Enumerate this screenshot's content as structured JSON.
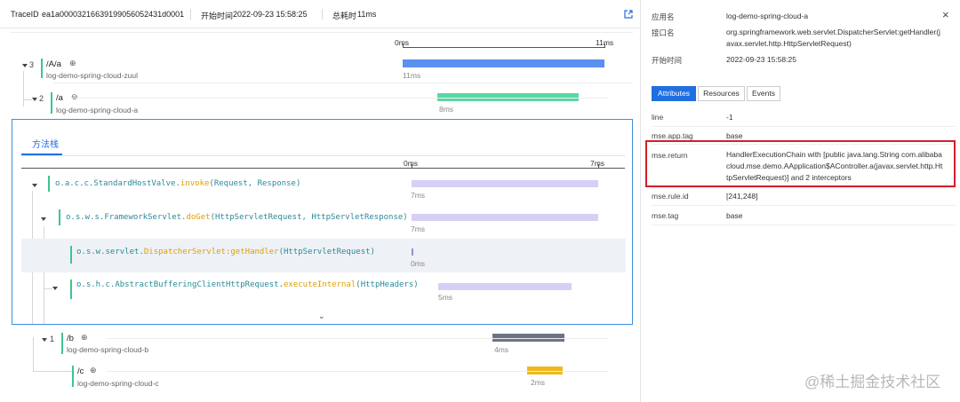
{
  "header": {
    "trace_label": "TraceID",
    "trace_id": "ea1a0000321663919905605243​1d0001",
    "start_label": "开始时间",
    "start_time": "2022-09-23 15:58:25",
    "total_label": "总耗时",
    "total_time": "11ms",
    "export_icon": "export-icon"
  },
  "timeline": {
    "start": "0ms",
    "end": "11ms"
  },
  "spans": [
    {
      "count": "3",
      "op": "/A/a",
      "service": "log-demo-spring-cloud-zuul",
      "duration": "11ms",
      "color": "#5b8ff0",
      "start_ms": 0,
      "dur_ms": 11
    },
    {
      "count": "2",
      "op": "/a",
      "service": "log-demo-spring-cloud-a",
      "duration": "8ms",
      "color": "#5ad7a4",
      "start_ms": 1.9,
      "dur_ms": 7.7
    },
    {
      "count": "1",
      "op": "/b",
      "service": "log-demo-spring-cloud-b",
      "duration": "4ms",
      "color": "#6b7485",
      "start_ms": 4.9,
      "dur_ms": 3.9
    },
    {
      "count": "",
      "op": "/c",
      "service": "log-demo-spring-cloud-c",
      "duration": "2ms",
      "color": "#f0b81c",
      "start_ms": 6.8,
      "dur_ms": 1.9
    }
  ],
  "stack": {
    "title": "方法栈",
    "scale_start": "0ms",
    "scale_end": "7ms",
    "methods": [
      {
        "cls": "o.a.c.c.StandardHostValve.",
        "meth": "invoke",
        "args": "(Request, Response)",
        "duration": "7ms",
        "start_ms": 0,
        "dur_ms": 7
      },
      {
        "cls": "o.s.w.s.FrameworkServlet.",
        "meth": "doGet",
        "args": "(HttpServletRequest, HttpServletResponse)",
        "duration": "7ms",
        "start_ms": 0,
        "dur_ms": 7
      },
      {
        "cls": "o.s.w.servlet.",
        "meth": "DispatcherServlet:getHandler",
        "args": "(HttpServletRequest)",
        "duration": "0ms",
        "start_ms": 0,
        "dur_ms": 0
      },
      {
        "cls": "o.s.h.c.AbstractBufferingClientHttpRequest.",
        "meth": "executeInternal",
        "args": "(HttpHeaders)",
        "duration": "5ms",
        "start_ms": 1,
        "dur_ms": 5
      }
    ]
  },
  "detail": {
    "app_label": "应用名",
    "app_value": "log-demo-spring-cloud-a",
    "iface_label": "接口名",
    "iface_value": "org.springframework.web.servlet.DispatcherServlet:getHandler(javax.servlet.http.HttpServletRequest)",
    "time_label": "开始时间",
    "time_value": "2022-09-23 15:58:25",
    "tabs": [
      "Attributes",
      "Resources",
      "Events"
    ],
    "attributes": [
      {
        "key": "line",
        "value": "-1"
      },
      {
        "key": "mse.app.tag",
        "value": "base"
      },
      {
        "key": "mse.return",
        "value": "HandlerExecutionChain with [public java.lang.String com.alibabacloud.mse.demo.AApplication$AController.a(javax.servlet.http.HttpServletRequest)] and 2 interceptors"
      },
      {
        "key": "mse.rule.id",
        "value": "[241,248]"
      },
      {
        "key": "mse.tag",
        "value": "base"
      }
    ]
  },
  "watermark": "@稀土掘金技术社区",
  "colors": {
    "accent": "#1f6fe0",
    "highlight_border": "#d0202a"
  }
}
